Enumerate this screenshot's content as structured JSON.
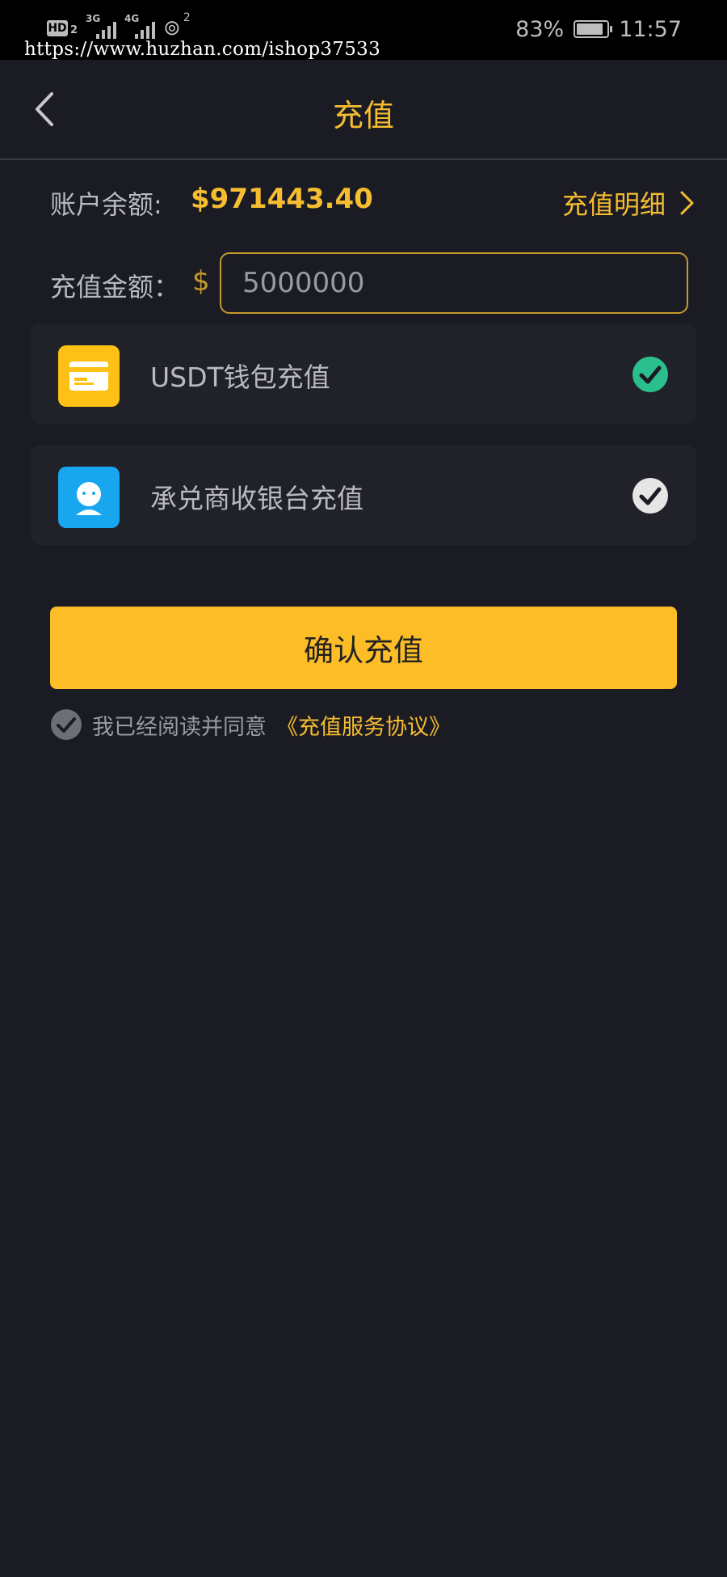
{
  "status_bar": {
    "hd_label": "HD",
    "hd_sub": "2",
    "net1_label": "3G",
    "net2_label": "4G",
    "hotspot_count": "2",
    "url": "https://www.huzhan.com/ishop37533",
    "battery_percent": "83%",
    "time": "11:57"
  },
  "header": {
    "title": "充值"
  },
  "balance": {
    "label": "账户余额:",
    "value": "$971443.40",
    "detail_link": "充值明细"
  },
  "amount": {
    "label": "充值金额：",
    "currency": "$",
    "value": "5000000"
  },
  "payment_options": [
    {
      "label": "USDT钱包充值",
      "selected": true,
      "icon": "card-icon",
      "icon_color": "#fcc114"
    },
    {
      "label": "承兑商收银台充值",
      "selected": false,
      "icon": "merchant-avatar-icon",
      "icon_color": "#18a7ee"
    }
  ],
  "confirm_button": "确认充值",
  "agreement": {
    "text": "我已经阅读并同意",
    "link": "《充值服务协议》"
  },
  "colors": {
    "background": "#1b1b24",
    "accent": "#f5bd2f",
    "button": "#fdbd27",
    "selected_check": "#2bbf8e"
  }
}
